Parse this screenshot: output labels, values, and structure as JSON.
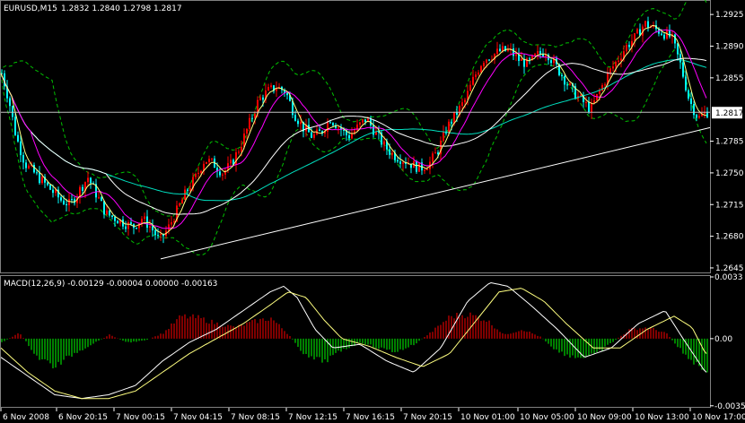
{
  "main_header": {
    "symbol": "EURUSD,M15",
    "ohlc": "1.2832 1.2840 1.2798 1.2817"
  },
  "indicator_header": {
    "label": "MACD(12,26,9) -0.00129 -0.00004 0.00000 -0.00163"
  },
  "current_price_box": "1.2817",
  "colors": {
    "background": "#000000",
    "bull_candle": "#ff0000",
    "bear_candle": "#00ffff",
    "bollinger": "#00c000",
    "ma_fast": "#ff00ff",
    "ma_mid": "#ffff80",
    "ma_slow": "#00e0c0",
    "ma_long": "#ffffff",
    "macd_pos": "#ff0000",
    "macd_neg": "#00ff00",
    "macd_line": "#ffffff",
    "signal_line": "#ffff80"
  },
  "chart_data": [
    {
      "type": "candlestick",
      "title": "EURUSD,M15",
      "ylim": [
        1.264,
        1.294
      ],
      "y_ticks": [
        "1.2925",
        "1.2890",
        "1.2855",
        "1.2817",
        "1.2785",
        "1.2750",
        "1.2715",
        "1.2680",
        "1.2645"
      ],
      "x_ticks": [
        "6 Nov 2008",
        "6 Nov 20:15",
        "7 Nov 00:15",
        "7 Nov 04:15",
        "7 Nov 08:15",
        "7 Nov 12:15",
        "7 Nov 16:15",
        "7 Nov 20:15",
        "10 Nov 01:00",
        "10 Nov 05:00",
        "10 Nov 09:00",
        "10 Nov 13:00",
        "10 Nov 17:00"
      ],
      "close_path": [
        [
          0,
          1.286
        ],
        [
          8,
          1.283
        ],
        [
          16,
          1.279
        ],
        [
          26,
          1.276
        ],
        [
          36,
          1.275
        ],
        [
          46,
          1.274
        ],
        [
          56,
          1.273
        ],
        [
          66,
          1.272
        ],
        [
          76,
          1.2715
        ],
        [
          86,
          1.273
        ],
        [
          96,
          1.2745
        ],
        [
          106,
          1.2725
        ],
        [
          116,
          1.2705
        ],
        [
          126,
          1.27
        ],
        [
          136,
          1.2695
        ],
        [
          146,
          1.269
        ],
        [
          156,
          1.27
        ],
        [
          166,
          1.269
        ],
        [
          176,
          1.2675
        ],
        [
          186,
          1.269
        ],
        [
          196,
          1.271
        ],
        [
          206,
          1.273
        ],
        [
          216,
          1.2745
        ],
        [
          226,
          1.2765
        ],
        [
          236,
          1.276
        ],
        [
          246,
          1.275
        ],
        [
          256,
          1.276
        ],
        [
          266,
          1.278
        ],
        [
          276,
          1.2805
        ],
        [
          286,
          1.283
        ],
        [
          296,
          1.284
        ],
        [
          306,
          1.2845
        ],
        [
          316,
          1.284
        ],
        [
          326,
          1.2815
        ],
        [
          336,
          1.28
        ],
        [
          346,
          1.279
        ],
        [
          356,
          1.2795
        ],
        [
          366,
          1.281
        ],
        [
          376,
          1.28
        ],
        [
          386,
          1.279
        ],
        [
          396,
          1.28
        ],
        [
          406,
          1.281
        ],
        [
          416,
          1.2795
        ],
        [
          426,
          1.278
        ],
        [
          436,
          1.277
        ],
        [
          446,
          1.2765
        ],
        [
          456,
          1.276
        ],
        [
          466,
          1.2755
        ],
        [
          476,
          1.276
        ],
        [
          486,
          1.2775
        ],
        [
          496,
          1.28
        ],
        [
          506,
          1.2815
        ],
        [
          516,
          1.283
        ],
        [
          526,
          1.2855
        ],
        [
          536,
          1.2875
        ],
        [
          546,
          1.288
        ],
        [
          556,
          1.2885
        ],
        [
          566,
          1.2885
        ],
        [
          576,
          1.2875
        ],
        [
          586,
          1.287
        ],
        [
          596,
          1.288
        ],
        [
          606,
          1.2885
        ],
        [
          616,
          1.287
        ],
        [
          626,
          1.2855
        ],
        [
          636,
          1.284
        ],
        [
          646,
          1.283
        ],
        [
          656,
          1.282
        ],
        [
          666,
          1.284
        ],
        [
          676,
          1.286
        ],
        [
          686,
          1.2875
        ],
        [
          696,
          1.289
        ],
        [
          706,
          1.29
        ],
        [
          716,
          1.2915
        ],
        [
          726,
          1.291
        ],
        [
          736,
          1.2905
        ],
        [
          746,
          1.29
        ],
        [
          756,
          1.287
        ],
        [
          766,
          1.283
        ],
        [
          776,
          1.281
        ],
        [
          784,
          1.2817
        ]
      ],
      "trendline": [
        [
          178,
          1.2655
        ],
        [
          790,
          1.28
        ]
      ],
      "current_price": 1.2817
    },
    {
      "type": "histogram",
      "title": "MACD(12,26,9)",
      "ylim": [
        -0.0036,
        0.0033
      ],
      "y_ticks": [
        "0.0033",
        "0.00",
        "-0.00359"
      ],
      "histogram": [
        [
          0,
          -0.0002
        ],
        [
          20,
          0.0003
        ],
        [
          40,
          -0.001
        ],
        [
          60,
          -0.0015
        ],
        [
          80,
          -0.0008
        ],
        [
          100,
          -0.0003
        ],
        [
          120,
          0.0002
        ],
        [
          140,
          -0.0002
        ],
        [
          160,
          -0.0001
        ],
        [
          180,
          0.0003
        ],
        [
          200,
          0.0012
        ],
        [
          220,
          0.0011
        ],
        [
          240,
          0.0008
        ],
        [
          260,
          0.0006
        ],
        [
          280,
          0.0009
        ],
        [
          300,
          0.0011
        ],
        [
          320,
          0.0002
        ],
        [
          340,
          -0.001
        ],
        [
          360,
          -0.0012
        ],
        [
          380,
          -0.0006
        ],
        [
          400,
          -0.0002
        ],
        [
          420,
          -0.0005
        ],
        [
          440,
          -0.0007
        ],
        [
          460,
          -0.0003
        ],
        [
          480,
          0.0004
        ],
        [
          500,
          0.0012
        ],
        [
          520,
          0.0013
        ],
        [
          540,
          0.001
        ],
        [
          560,
          0.0002
        ],
        [
          580,
          0.0005
        ],
        [
          600,
          0.0001
        ],
        [
          620,
          -0.0007
        ],
        [
          640,
          -0.001
        ],
        [
          660,
          -0.0009
        ],
        [
          680,
          -0.0002
        ],
        [
          700,
          0.0005
        ],
        [
          720,
          0.0006
        ],
        [
          740,
          0.0003
        ],
        [
          760,
          -0.0008
        ],
        [
          780,
          -0.0016
        ]
      ],
      "macd": [
        [
          0,
          -0.001
        ],
        [
          30,
          -0.002
        ],
        [
          60,
          -0.003
        ],
        [
          90,
          -0.0032
        ],
        [
          120,
          -0.003
        ],
        [
          150,
          -0.0025
        ],
        [
          180,
          -0.0012
        ],
        [
          210,
          -0.0002
        ],
        [
          240,
          0.0005
        ],
        [
          270,
          0.0015
        ],
        [
          300,
          0.0025
        ],
        [
          315,
          0.0028
        ],
        [
          330,
          0.0022
        ],
        [
          350,
          0.0005
        ],
        [
          370,
          -0.0005
        ],
        [
          400,
          -0.0003
        ],
        [
          430,
          -0.0012
        ],
        [
          460,
          -0.0018
        ],
        [
          490,
          -0.0005
        ],
        [
          520,
          0.002
        ],
        [
          545,
          0.003
        ],
        [
          565,
          0.0028
        ],
        [
          590,
          0.0018
        ],
        [
          620,
          0.0005
        ],
        [
          650,
          -0.001
        ],
        [
          680,
          -0.0005
        ],
        [
          710,
          0.0008
        ],
        [
          740,
          0.0015
        ],
        [
          760,
          0.0
        ],
        [
          785,
          -0.0018
        ]
      ],
      "signal": [
        [
          0,
          -0.0005
        ],
        [
          30,
          -0.0018
        ],
        [
          60,
          -0.0028
        ],
        [
          90,
          -0.0032
        ],
        [
          120,
          -0.0032
        ],
        [
          150,
          -0.0028
        ],
        [
          180,
          -0.0018
        ],
        [
          210,
          -0.0008
        ],
        [
          240,
          0.0
        ],
        [
          270,
          0.0008
        ],
        [
          300,
          0.0018
        ],
        [
          320,
          0.0025
        ],
        [
          340,
          0.0022
        ],
        [
          360,
          0.001
        ],
        [
          380,
          0.0
        ],
        [
          410,
          -0.0004
        ],
        [
          440,
          -0.001
        ],
        [
          470,
          -0.0015
        ],
        [
          500,
          -0.0008
        ],
        [
          530,
          0.001
        ],
        [
          555,
          0.0025
        ],
        [
          580,
          0.0027
        ],
        [
          605,
          0.002
        ],
        [
          630,
          0.0008
        ],
        [
          660,
          -0.0005
        ],
        [
          690,
          -0.0005
        ],
        [
          720,
          0.0005
        ],
        [
          750,
          0.0012
        ],
        [
          770,
          0.0006
        ],
        [
          785,
          -0.0008
        ]
      ]
    }
  ]
}
